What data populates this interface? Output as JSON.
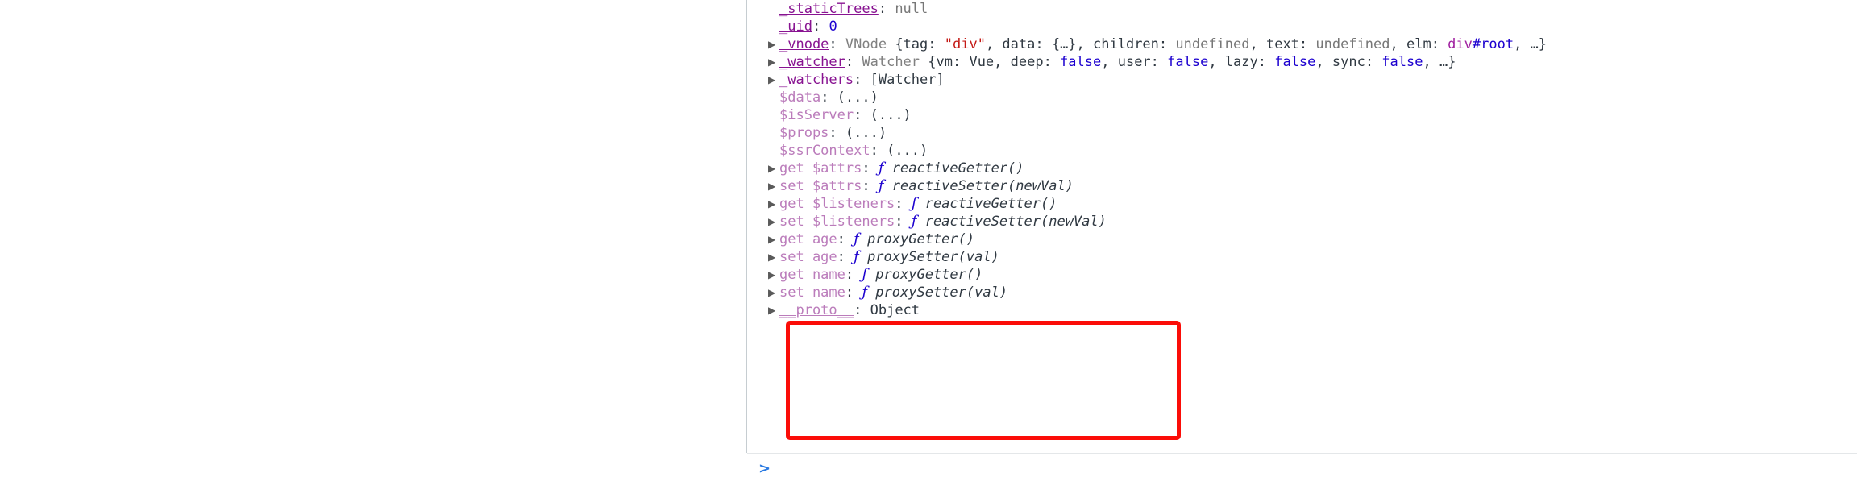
{
  "console": {
    "prompt_symbol": ">",
    "prompt_value": "",
    "prompt_placeholder": "",
    "lines": [
      {
        "id": "staticTrees",
        "expandable": false,
        "key": "_staticTrees",
        "key_kind": "own",
        "sep": ": ",
        "value_text": "null",
        "value_kind": "null"
      },
      {
        "id": "uid",
        "expandable": false,
        "key": "_uid",
        "key_kind": "own",
        "sep": ": ",
        "value_text": "0",
        "value_kind": "number"
      },
      {
        "id": "vnode",
        "expandable": true,
        "key": "_vnode",
        "key_kind": "own",
        "sep": ": ",
        "value_kind": "object-preview",
        "value_class": "VNode",
        "preview": "{tag: \"div\", data: {…}, children: undefined, text: undefined, elm: div#root, …}"
      },
      {
        "id": "watcher",
        "expandable": true,
        "key": "_watcher",
        "key_kind": "own",
        "sep": ": ",
        "value_kind": "object-preview",
        "value_class": "Watcher",
        "preview": "{vm: Vue, deep: false, user: false, lazy: false, sync: false, …}"
      },
      {
        "id": "watchers",
        "expandable": true,
        "key": "_watchers",
        "key_kind": "own",
        "sep": ": ",
        "value_text": "[Watcher]",
        "value_kind": "plain"
      },
      {
        "id": "data",
        "expandable": false,
        "key": "$data",
        "key_kind": "accessor",
        "sep": ": ",
        "value_text": "(...)",
        "value_kind": "plain"
      },
      {
        "id": "isServer",
        "expandable": false,
        "key": "$isServer",
        "key_kind": "accessor",
        "sep": ": ",
        "value_text": "(...)",
        "value_kind": "plain"
      },
      {
        "id": "props",
        "expandable": false,
        "key": "$props",
        "key_kind": "accessor",
        "sep": ": ",
        "value_text": "(...)",
        "value_kind": "plain"
      },
      {
        "id": "ssrContext",
        "expandable": false,
        "key": "$ssrContext",
        "key_kind": "accessor",
        "sep": ": ",
        "value_text": "(...)",
        "value_kind": "plain"
      },
      {
        "id": "get-attrs",
        "expandable": true,
        "key": "get $attrs",
        "key_kind": "accessor",
        "sep": ": ",
        "value_kind": "function",
        "fn_symbol": "ƒ",
        "fn_name": "reactiveGetter()"
      },
      {
        "id": "set-attrs",
        "expandable": true,
        "key": "set $attrs",
        "key_kind": "accessor",
        "sep": ": ",
        "value_kind": "function",
        "fn_symbol": "ƒ",
        "fn_name": "reactiveSetter(newVal)"
      },
      {
        "id": "get-listeners",
        "expandable": true,
        "key": "get $listeners",
        "key_kind": "accessor",
        "sep": ": ",
        "value_kind": "function",
        "fn_symbol": "ƒ",
        "fn_name": "reactiveGetter()"
      },
      {
        "id": "set-listeners",
        "expandable": true,
        "key": "set $listeners",
        "key_kind": "accessor",
        "sep": ": ",
        "value_kind": "function",
        "fn_symbol": "ƒ",
        "fn_name": "reactiveSetter(newVal)"
      },
      {
        "id": "get-age",
        "expandable": true,
        "key": "get age",
        "key_kind": "accessor",
        "sep": ": ",
        "value_kind": "function",
        "fn_symbol": "ƒ",
        "fn_name": "proxyGetter()"
      },
      {
        "id": "set-age",
        "expandable": true,
        "key": "set age",
        "key_kind": "accessor",
        "sep": ": ",
        "value_kind": "function",
        "fn_symbol": "ƒ",
        "fn_name": "proxySetter(val)"
      },
      {
        "id": "get-name",
        "expandable": true,
        "key": "get name",
        "key_kind": "accessor",
        "sep": ": ",
        "value_kind": "function",
        "fn_symbol": "ƒ",
        "fn_name": "proxyGetter()"
      },
      {
        "id": "set-name",
        "expandable": true,
        "key": "set name",
        "key_kind": "accessor",
        "sep": ": ",
        "value_kind": "function",
        "fn_symbol": "ƒ",
        "fn_name": "proxySetter(val)"
      },
      {
        "id": "proto",
        "expandable": true,
        "key": "__proto__",
        "key_kind": "proto",
        "sep": ": ",
        "value_text": "Object",
        "value_kind": "objname"
      }
    ],
    "vnode_preview_tokens": [
      {
        "t": "{tag: ",
        "c": "plain"
      },
      {
        "t": "\"div\"",
        "c": "string"
      },
      {
        "t": ", data: ",
        "c": "plain"
      },
      {
        "t": "{…}",
        "c": "plain"
      },
      {
        "t": ", children: ",
        "c": "plain"
      },
      {
        "t": "undefined",
        "c": "undef"
      },
      {
        "t": ", text: ",
        "c": "plain"
      },
      {
        "t": "undefined",
        "c": "undef"
      },
      {
        "t": ", elm: ",
        "c": "plain"
      },
      {
        "t": "div",
        "c": "tagname"
      },
      {
        "t": "#root",
        "c": "tagid"
      },
      {
        "t": ", …}",
        "c": "plain"
      }
    ],
    "watcher_preview_tokens": [
      {
        "t": "{vm: ",
        "c": "plain"
      },
      {
        "t": "Vue",
        "c": "plain"
      },
      {
        "t": ", deep: ",
        "c": "plain"
      },
      {
        "t": "false",
        "c": "bool"
      },
      {
        "t": ", user: ",
        "c": "plain"
      },
      {
        "t": "false",
        "c": "bool"
      },
      {
        "t": ", lazy: ",
        "c": "plain"
      },
      {
        "t": "false",
        "c": "bool"
      },
      {
        "t": ", sync: ",
        "c": "plain"
      },
      {
        "t": "false",
        "c": "bool"
      },
      {
        "t": ", …}",
        "c": "plain"
      }
    ],
    "disclosure_glyph": "▶"
  },
  "annotation": {
    "shape": "rectangle",
    "color": "#fb0d08",
    "covers": [
      "get age",
      "set age",
      "get name",
      "set name"
    ]
  },
  "colors": {
    "own_key": "#881391",
    "accessor_key": "#bb7cbb",
    "string": "#c41a16",
    "number": "#1c00cf",
    "boolean": "#1c00cf",
    "nullish": "#777777",
    "function_symbol": "#1c00cf",
    "annotation_red": "#fb0d08",
    "divider": "#c6cdd1",
    "prompt_chevron": "#2a7ae2"
  }
}
